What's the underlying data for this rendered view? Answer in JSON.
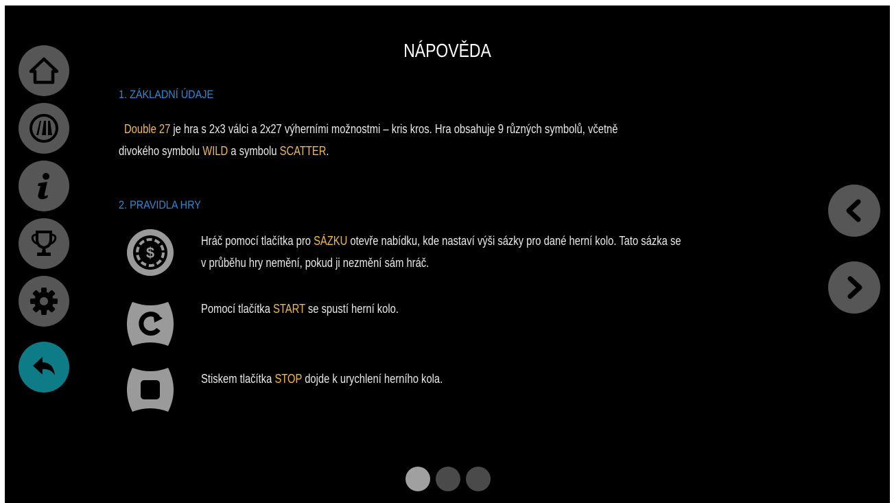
{
  "header": {
    "title": "NÁPOVĚDA"
  },
  "sidebar": {
    "items": [
      {
        "name": "home",
        "icon": "home-icon"
      },
      {
        "name": "game",
        "icon": "game-logo-icon"
      },
      {
        "name": "info",
        "icon": "info-icon"
      },
      {
        "name": "trophy",
        "icon": "trophy-icon"
      },
      {
        "name": "settings",
        "icon": "gear-icon"
      },
      {
        "name": "back",
        "icon": "back-arrow-icon",
        "active": true
      }
    ]
  },
  "section1": {
    "heading": "1. ZÁKLADNÍ ÚDAJE",
    "line1": {
      "hl1": "Double 27",
      "t1": " je hra s 2x3 válci a 2x27 výherními možnostmi – kris kros. Hra obsahuje 9 různých symbolů, včetně"
    },
    "line2": {
      "t1": "divokého symbolu ",
      "hl1": "WILD",
      "t2": " a symbolu ",
      "hl2": "SCATTER",
      "t3": "."
    }
  },
  "section2": {
    "heading": "2. PRAVIDLA HRY",
    "rules": [
      {
        "icon": "bet-coin-icon",
        "line1": {
          "t1": "Hráč pomocí tlačítka pro ",
          "hl1": "SÁZKU",
          "t2": " otevře nabídku, kde nastaví výši sázky pro dané herní kolo. Tato sázka se"
        },
        "line2": {
          "t1": "v průběhu hry nemění, pokud ji nezmění sám hráč."
        }
      },
      {
        "icon": "start-icon",
        "line1": {
          "t1": "Pomocí tlačítka ",
          "hl1": "START",
          "t2": " se spustí herní kolo."
        }
      },
      {
        "icon": "stop-icon",
        "line1": {
          "t1": "Stiskem tlačítka ",
          "hl1": "STOP",
          "t2": " dojde k urychlení herního kola."
        }
      }
    ]
  },
  "navigation": {
    "prev_icon": "chevron-left-icon",
    "next_icon": "chevron-right-icon"
  },
  "pagination": {
    "current": 1,
    "total": 3
  },
  "colors": {
    "background": "#000000",
    "button": "#565656",
    "active_button": "#0e7c86",
    "heading": "#2b89d8",
    "highlight": "#f3b94a",
    "text": "#e9e9e9"
  }
}
